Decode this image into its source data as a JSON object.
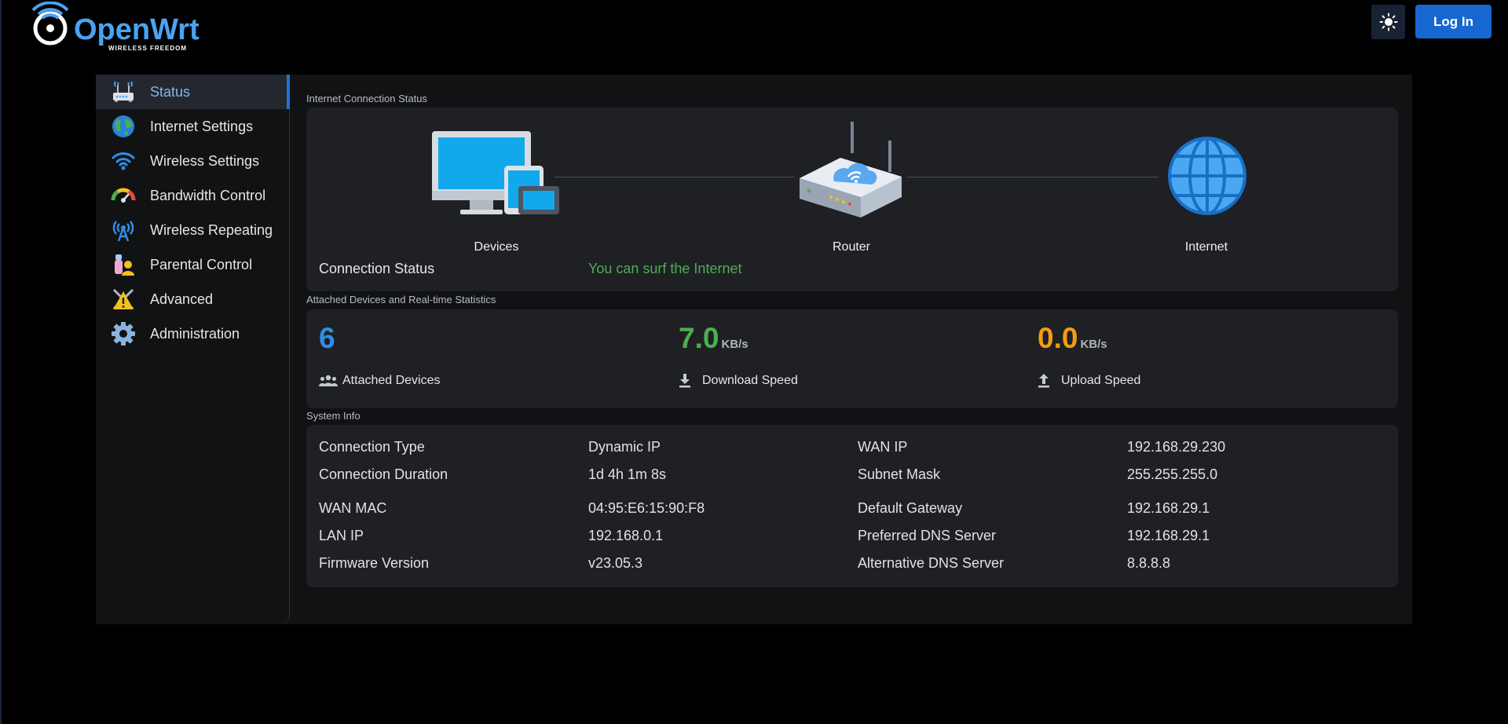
{
  "header": {
    "logo_text": "OpenWrt",
    "logo_tagline": "WIRELESS FREEDOM",
    "theme_icon": "sun-icon",
    "login_label": "Log In"
  },
  "sidebar": {
    "items": [
      {
        "label": "Status",
        "icon": "router-icon",
        "active": true
      },
      {
        "label": "Internet Settings",
        "icon": "globe-icon"
      },
      {
        "label": "Wireless Settings",
        "icon": "wifi-icon"
      },
      {
        "label": "Bandwidth Control",
        "icon": "gauge-icon"
      },
      {
        "label": "Wireless Repeating",
        "icon": "antenna-icon"
      },
      {
        "label": "Parental Control",
        "icon": "parental-icon"
      },
      {
        "label": "Advanced",
        "icon": "warning-tools-icon"
      },
      {
        "label": "Administration",
        "icon": "gear-icon"
      }
    ]
  },
  "internet_status": {
    "section_title": "Internet Connection Status",
    "devices_label": "Devices",
    "router_label": "Router",
    "internet_label": "Internet",
    "connection_status_label": "Connection Status",
    "connection_status_value": "You can surf the Internet"
  },
  "stats": {
    "section_title": "Attached Devices and Real-time Statistics",
    "attached_devices": {
      "value": "6",
      "label": "Attached Devices",
      "color": "#2f8fe8"
    },
    "download": {
      "value": "7.0",
      "unit": "KB/s",
      "label": "Download Speed",
      "color": "#4caf50"
    },
    "upload": {
      "value": "0.0",
      "unit": "KB/s",
      "label": "Upload Speed",
      "color": "#f39c12"
    }
  },
  "system_info": {
    "section_title": "System Info",
    "left": [
      {
        "label": "Connection Type",
        "value": "Dynamic IP"
      },
      {
        "label": "Connection Duration",
        "value": "1d 4h 1m 8s"
      },
      {
        "label": "WAN MAC",
        "value": "04:95:E6:15:90:F8"
      },
      {
        "label": "LAN IP",
        "value": "192.168.0.1"
      },
      {
        "label": "Firmware Version",
        "value": "v23.05.3"
      }
    ],
    "right": [
      {
        "label": "WAN IP",
        "value": "192.168.29.230"
      },
      {
        "label": "Subnet Mask",
        "value": "255.255.255.0"
      },
      {
        "label": "Default Gateway",
        "value": "192.168.29.1"
      },
      {
        "label": "Preferred DNS Server",
        "value": "192.168.29.1"
      },
      {
        "label": "Alternative DNS Server",
        "value": "8.8.8.8"
      }
    ]
  },
  "colors": {
    "accent": "#1e74d8",
    "success": "#4caf50",
    "warning": "#f39c12"
  }
}
